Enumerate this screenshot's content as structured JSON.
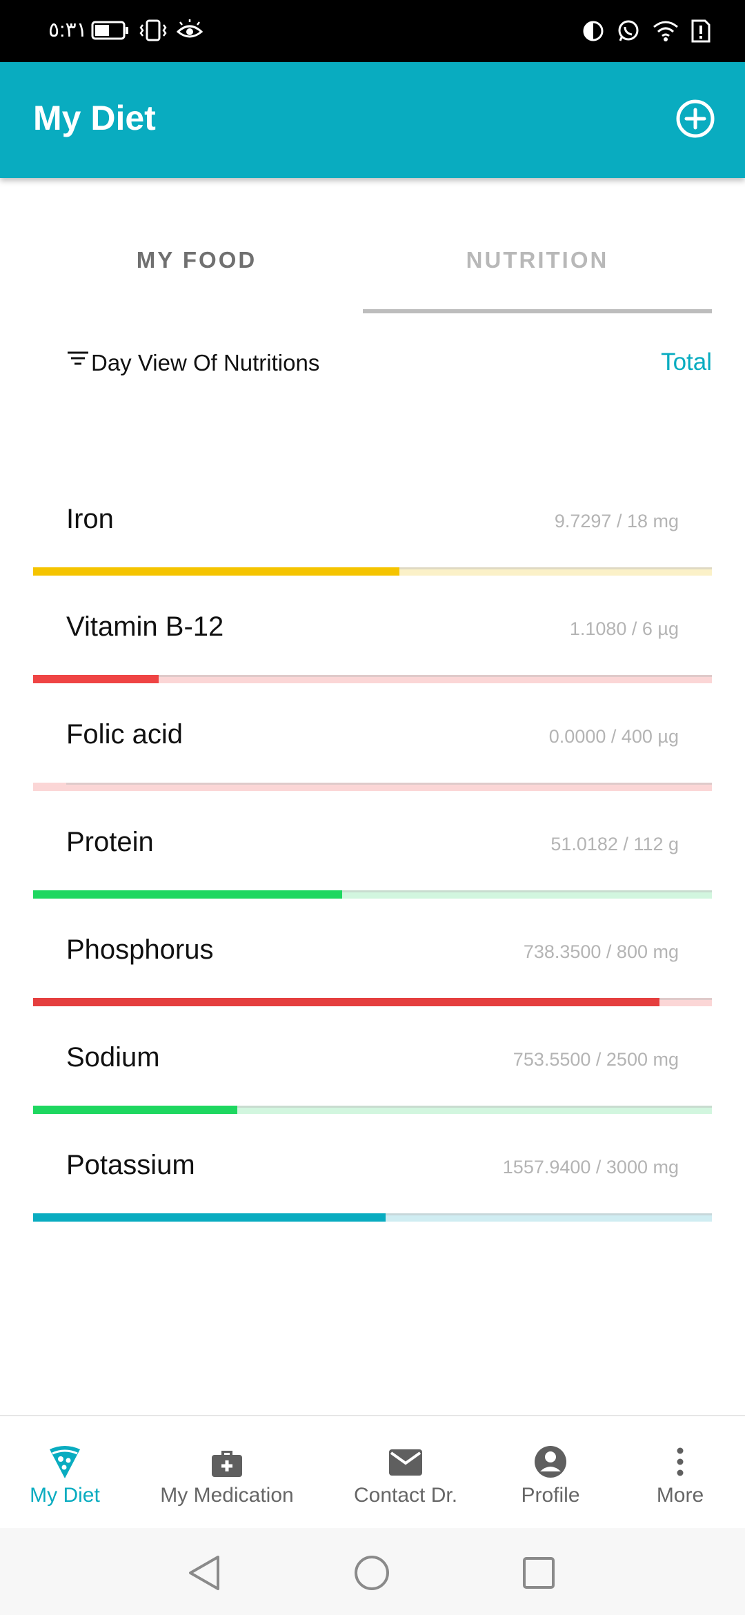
{
  "status_bar": {
    "time": "٥:٣١"
  },
  "app_bar": {
    "title": "My Diet",
    "add_icon": "add-circle-icon"
  },
  "tabs": [
    {
      "label": "MY FOOD",
      "active": false
    },
    {
      "label": "NUTRITION",
      "active": true
    }
  ],
  "filter": {
    "label": "Day View Of Nutritions",
    "total_label": "Total"
  },
  "nutrients": [
    {
      "name": "Iron",
      "value_text": "9.7297 / 18 mg",
      "progress": 0.54,
      "color": "#f5c400",
      "track_color": "#fbf1c8"
    },
    {
      "name": "Vitamin B-12",
      "value_text": "1.1080 / 6 µg",
      "progress": 0.185,
      "color": "#ef4444",
      "track_color": "#fbd6d6"
    },
    {
      "name": "Folic acid",
      "value_text": "0.0000 / 400 µg",
      "progress": 0.0,
      "color": "#ef4444",
      "track_color": "#fbd6d6"
    },
    {
      "name": "Protein",
      "value_text": "51.0182 / 112 g",
      "progress": 0.455,
      "color": "#1ed760",
      "track_color": "#d2f6df"
    },
    {
      "name": "Phosphorus",
      "value_text": "738.3500 / 800 mg",
      "progress": 0.923,
      "color": "#e53e3e",
      "track_color": "#fbd6d6"
    },
    {
      "name": "Sodium",
      "value_text": "753.5500 / 2500 mg",
      "progress": 0.301,
      "color": "#1ed760",
      "track_color": "#d2f6df"
    },
    {
      "name": "Potassium",
      "value_text": "1557.9400 / 3000 mg",
      "progress": 0.519,
      "color": "#09acc0",
      "track_color": "#d0edf2"
    }
  ],
  "bottom_nav": [
    {
      "label": "My Diet",
      "icon": "pizza-icon",
      "active": true
    },
    {
      "label": "My Medication",
      "icon": "medkit-icon",
      "active": false
    },
    {
      "label": "Contact Dr.",
      "icon": "mail-icon",
      "active": false
    },
    {
      "label": "Profile",
      "icon": "account-icon",
      "active": false
    },
    {
      "label": "More",
      "icon": "more-vertical-icon",
      "active": false
    }
  ],
  "colors": {
    "accent": "#09acc0",
    "status_bar": "#000000"
  }
}
